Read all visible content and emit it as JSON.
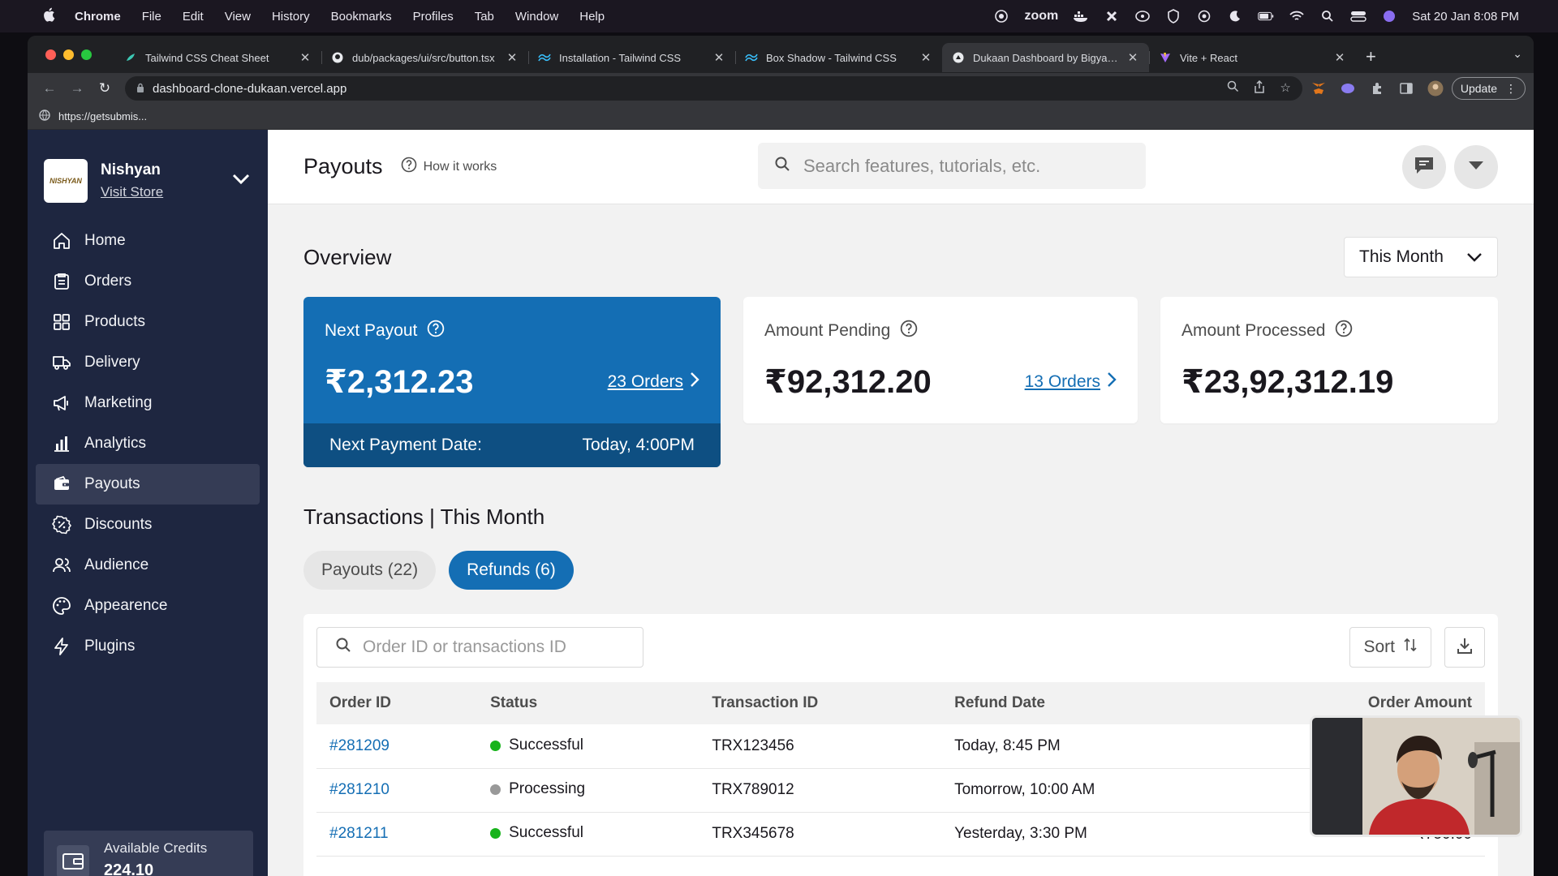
{
  "menubar": {
    "app": "Chrome",
    "items": [
      "File",
      "Edit",
      "View",
      "History",
      "Bookmarks",
      "Profiles",
      "Tab",
      "Window",
      "Help"
    ],
    "zoom_label": "zoom",
    "datetime": "Sat 20 Jan  8:08 PM"
  },
  "browser": {
    "tabs": [
      {
        "title": "Tailwind CSS Cheat Sheet",
        "icon": "tailwind-cheatsheet-icon"
      },
      {
        "title": "dub/packages/ui/src/button.tsx",
        "icon": "github-icon"
      },
      {
        "title": "Installation - Tailwind CSS",
        "icon": "tailwind-icon"
      },
      {
        "title": "Box Shadow - Tailwind CSS",
        "icon": "tailwind-icon"
      },
      {
        "title": "Dukaan Dashboard by Bigyan Bhattarai",
        "icon": "vercel-icon"
      },
      {
        "title": "Vite + React",
        "icon": "vite-icon"
      }
    ],
    "active_tab": 4,
    "url": "dashboard-clone-dukaan.vercel.app",
    "bookmark": "https://getsubmis...",
    "update_label": "Update"
  },
  "sidebar": {
    "store_name": "Nishyan",
    "logo_text": "NISHYAN",
    "visit_store": "Visit Store",
    "items": [
      {
        "label": "Home",
        "icon": "home-icon"
      },
      {
        "label": "Orders",
        "icon": "orders-icon"
      },
      {
        "label": "Products",
        "icon": "products-icon"
      },
      {
        "label": "Delivery",
        "icon": "truck-icon"
      },
      {
        "label": "Marketing",
        "icon": "megaphone-icon"
      },
      {
        "label": "Analytics",
        "icon": "bar-chart-icon"
      },
      {
        "label": "Payouts",
        "icon": "wallet-icon"
      },
      {
        "label": "Discounts",
        "icon": "discount-icon"
      },
      {
        "label": "Audience",
        "icon": "users-icon"
      },
      {
        "label": "Appearence",
        "icon": "palette-icon"
      },
      {
        "label": "Plugins",
        "icon": "bolt-icon"
      }
    ],
    "active_item": 6,
    "credits_label": "Available Credits",
    "credits_value": "224.10"
  },
  "header": {
    "title": "Payouts",
    "how_it_works": "How it works",
    "search_placeholder": "Search features, tutorials, etc."
  },
  "overview": {
    "title": "Overview",
    "period": "This Month",
    "next_payout": {
      "label": "Next Payout",
      "amount": "₹2,312.23",
      "orders": "23 Orders",
      "date_label": "Next Payment Date:",
      "date_value": "Today, 4:00PM"
    },
    "pending": {
      "label": "Amount Pending",
      "amount": "₹92,312.20",
      "orders": "13 Orders"
    },
    "processed": {
      "label": "Amount Processed",
      "amount": "₹23,92,312.19"
    }
  },
  "transactions": {
    "title": "Transactions | This Month",
    "tabs": [
      "Payouts (22)",
      "Refunds (6)"
    ],
    "active_tab": 1,
    "search_placeholder": "Order ID or transactions ID",
    "sort_label": "Sort",
    "columns": [
      "Order ID",
      "Status",
      "Transaction ID",
      "Refund Date",
      "Order Amount"
    ],
    "rows": [
      {
        "order_id": "#281209",
        "status": "Successful",
        "status_color": "#17b31b",
        "transaction_id": "TRX123456",
        "refund_date": "Today, 8:45 PM",
        "amount": ""
      },
      {
        "order_id": "#281210",
        "status": "Processing",
        "status_color": "#999999",
        "transaction_id": "TRX789012",
        "refund_date": "Tomorrow, 10:00 AM",
        "amount": ""
      },
      {
        "order_id": "#281211",
        "status": "Successful",
        "status_color": "#17b31b",
        "transaction_id": "TRX345678",
        "refund_date": "Yesterday, 3:30 PM",
        "amount": "₹750.00"
      }
    ]
  },
  "colors": {
    "accent": "#146eb4",
    "sidebar": "#1e2640",
    "success": "#17b31b",
    "processing": "#999999"
  }
}
